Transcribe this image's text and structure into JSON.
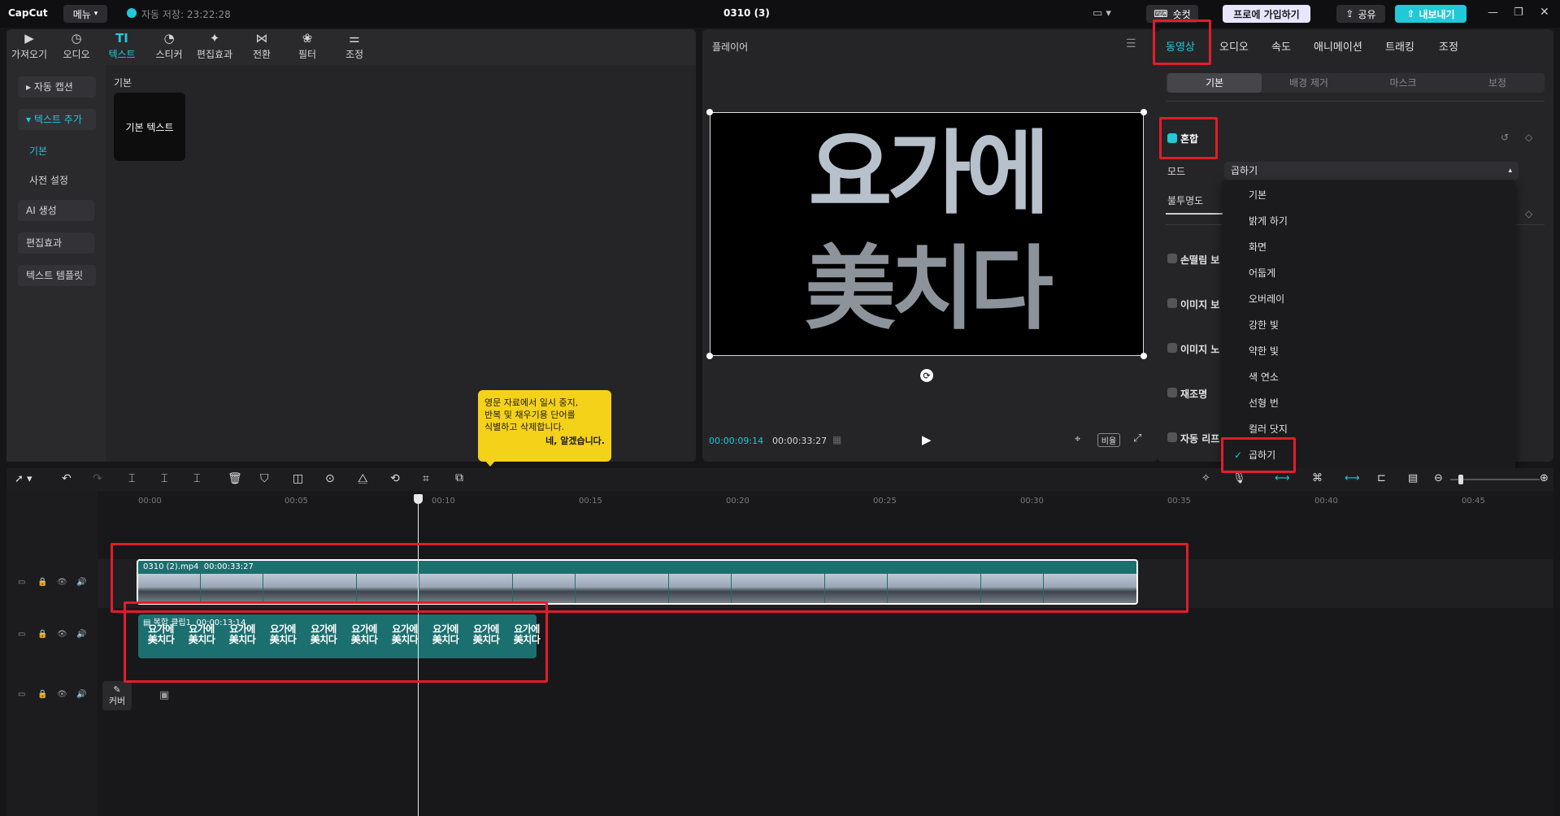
{
  "app": {
    "logo": "CapCut",
    "menu_label": "메뉴",
    "autosave": "자동 저장: 23:22:28",
    "project_title": "0310 (3)",
    "shortcut_label": "숏컷",
    "pro_label": "프로에 가입하기",
    "share_label": "공유",
    "export_label": "내보내기"
  },
  "toolbar": {
    "items": [
      "가져오기",
      "오디오",
      "텍스트",
      "스티커",
      "편집효과",
      "전환",
      "필터",
      "조정"
    ]
  },
  "left_panel": {
    "items": [
      "자동 캡션",
      "텍스트 추가",
      "기본",
      "사전 설정",
      "AI 생성",
      "편집효과",
      "텍스트 템플릿"
    ],
    "section_title": "기본",
    "card_label": "기본 텍스트"
  },
  "player": {
    "title": "플레이어",
    "overlay_line1": "요가에",
    "overlay_line2": "美치다",
    "current_time": "00:00:09:14",
    "total_time": "00:00:33:27",
    "ratio_label": "비율"
  },
  "right_panel": {
    "tabs": [
      "동영상",
      "오디오",
      "속도",
      "애니메이션",
      "트래킹",
      "조정"
    ],
    "subtabs": [
      "기본",
      "배경 제거",
      "마스크",
      "보정"
    ],
    "blend_label": "혼합",
    "mode_label": "모드",
    "mode_value": "곱하기",
    "opacity_label": "불투명도",
    "rows": [
      "손떨림 보",
      "이미지 보",
      "이미지 노",
      "재조명",
      "자동 리프"
    ],
    "dropdown_options": [
      "기본",
      "밝게 하기",
      "화면",
      "어둡게",
      "오버레이",
      "강한 빛",
      "약한 빛",
      "색 연소",
      "선형 번",
      "컬러 닷지",
      "곱하기"
    ],
    "selected_option": "곱하기"
  },
  "tooltip": {
    "text_line1": "영문 자료에서 일시 중지,",
    "text_line2": "반복 및 채우기용 단어를",
    "text_line3": "식별하고 삭제합니다.",
    "confirm": "네, 알겠습니다."
  },
  "timeline": {
    "ruler": [
      "00:00",
      "00:05",
      "00:10",
      "00:15",
      "00:20",
      "00:25",
      "00:30",
      "00:35",
      "00:40",
      "00:45"
    ],
    "clip1": {
      "name": "0310 (2).mp4",
      "duration": "00:00:33:27"
    },
    "clip2": {
      "name": "복합 클립1",
      "duration": "00:00:13:14",
      "thumb_line1": "요가에",
      "thumb_line2": "美치다"
    },
    "cover_label": "커버"
  },
  "colors": {
    "accent": "#21c8d8",
    "highlight": "#e11d2a",
    "tooltip": "#f5d21a",
    "clip_teal": "#1c6f6f"
  }
}
